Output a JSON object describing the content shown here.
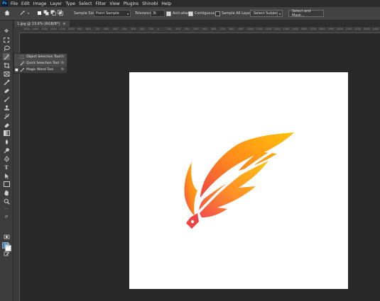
{
  "menubar": {
    "logo": "Ps",
    "items": [
      "File",
      "Edit",
      "Image",
      "Layer",
      "Type",
      "Select",
      "Filter",
      "View",
      "Plugins",
      "Shinobi",
      "Help"
    ]
  },
  "options": {
    "sample_size_label": "Sample Size:",
    "sample_size_value": "Point Sample",
    "tolerance_label": "Tolerance:",
    "tolerance_value": "3t",
    "antialias_label": "Anti-alias",
    "contiguous_label": "Contiguous",
    "sample_all_layers_label": "Sample All Layers",
    "select_subject_label": "Select Subject",
    "select_and_mask_label": "Select and Mask..."
  },
  "document": {
    "tab_title": "1.jpg @ 33.6% (RGB/8*)",
    "close_glyph": "×"
  },
  "ruler": {
    "ticks": [
      "1500",
      "1400",
      "1300",
      "1200",
      "1100",
      "1000",
      "900",
      "800",
      "700",
      "600",
      "500",
      "400",
      "300",
      "200",
      "100",
      "0",
      "100",
      "200",
      "300",
      "400",
      "500",
      "600",
      "700",
      "800",
      "900",
      "1000",
      "1100",
      "1200",
      "1300",
      "1400",
      "1500",
      "1600",
      "1700",
      "1800",
      "1900",
      "2000",
      "2100",
      "2200",
      "2300",
      "2400"
    ]
  },
  "flyout": {
    "items": [
      {
        "label": "Object Selection Tool",
        "key": "W",
        "icon": "object-selection-icon"
      },
      {
        "label": "Quick Selection Tool",
        "key": "W",
        "icon": "quick-selection-icon"
      },
      {
        "label": "Magic Wand Tool",
        "key": "W",
        "icon": "magic-wand-icon",
        "selected": true
      }
    ]
  },
  "colors": {
    "foreground": "#1a6fb3",
    "background": "#ffffff",
    "canvas": "#ffffff",
    "workspace": "#282828",
    "feather_start": "#ffc107",
    "feather_end": "#ef4444"
  }
}
